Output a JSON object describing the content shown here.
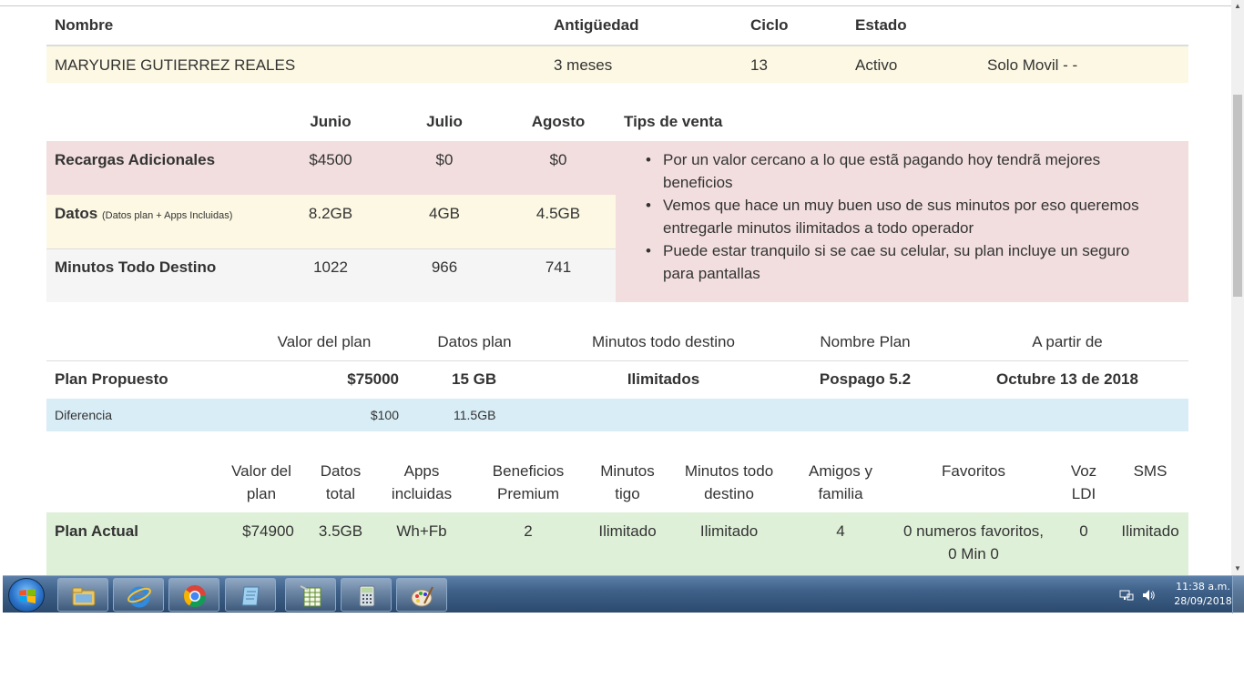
{
  "customer": {
    "headers": {
      "nombre": "Nombre",
      "antiguedad": "Antigüedad",
      "ciclo": "Ciclo",
      "estado": "Estado"
    },
    "row": {
      "nombre": "MARYURIE GUTIERREZ REALES",
      "antiguedad": "3 meses",
      "ciclo": "13",
      "estado": "Activo",
      "plan": "Solo Movil - -"
    }
  },
  "usage": {
    "months": [
      "Junio",
      "Julio",
      "Agosto"
    ],
    "tips_header": "Tips de venta",
    "rows": [
      {
        "label": "Recargas Adicionales",
        "note": "",
        "values": [
          "$4500",
          "$0",
          "$0"
        ]
      },
      {
        "label": "Datos",
        "note": "(Datos plan + Apps Incluidas)",
        "values": [
          "8.2GB",
          "4GB",
          "4.5GB"
        ]
      },
      {
        "label": "Minutos Todo Destino",
        "note": "",
        "values": [
          "1022",
          "966",
          "741"
        ]
      }
    ],
    "tips": [
      {
        "line1": "Por un valor cercano a lo que estã pagando hoy tendrã mejores",
        "line2": "beneficios"
      },
      {
        "line1": "Vemos que hace un muy buen uso de sus minutos por eso queremos",
        "line2": "entregarle minutos ilimitados a todo operador"
      },
      {
        "line1": "Puede estar tranquilo si se cae su celular, su plan incluye un seguro",
        "line2": "para pantallas"
      }
    ]
  },
  "proposed": {
    "headers": {
      "valor": "Valor del plan",
      "datos": "Datos plan",
      "minutos": "Minutos todo destino",
      "nombre": "Nombre Plan",
      "desde": "A partir de"
    },
    "row": {
      "label": "Plan Propuesto",
      "valor": "$75000",
      "datos": "15 GB",
      "minutos": "Ilimitados",
      "nombre": "Pospago 5.2",
      "desde": "Octubre 13 de 2018"
    },
    "diff": {
      "label": "Diferencia",
      "valor": "$100",
      "datos": "11.5GB"
    }
  },
  "current": {
    "headers": [
      {
        "l1": "Valor del",
        "l2": "plan"
      },
      {
        "l1": "Datos",
        "l2": "total"
      },
      {
        "l1": "Apps",
        "l2": "incluidas"
      },
      {
        "l1": "Beneficios",
        "l2": "Premium"
      },
      {
        "l1": "Minutos",
        "l2": "tigo"
      },
      {
        "l1": "Minutos todo",
        "l2": "destino"
      },
      {
        "l1": "Amigos y",
        "l2": "familia"
      },
      {
        "l1": "Favoritos",
        "l2": ""
      },
      {
        "l1": "Voz",
        "l2": "LDI"
      },
      {
        "l1": "SMS",
        "l2": ""
      }
    ],
    "row": {
      "label": "Plan Actual",
      "values": [
        "$74900",
        "3.5GB",
        "Wh+Fb",
        "2",
        "Ilimitado",
        "Ilimitado",
        "4",
        "0 numeros favoritos,",
        "0",
        "Ilimitado"
      ],
      "fav_line2": "0 Min 0"
    }
  },
  "colors": {
    "row_yellow": "#fcf8e3",
    "row_red": "#f2dede",
    "row_blue": "#d9edf7",
    "row_green": "#dff0d8",
    "row_gray": "#f5f5f5"
  },
  "taskbar": {
    "apps": [
      "windows-explorer-icon",
      "internet-explorer-icon",
      "chrome-icon",
      "notepad-icon",
      "excel-icon",
      "calculator-icon",
      "paint-icon"
    ],
    "time": "11:38 a.m.",
    "date": "28/09/2018"
  }
}
